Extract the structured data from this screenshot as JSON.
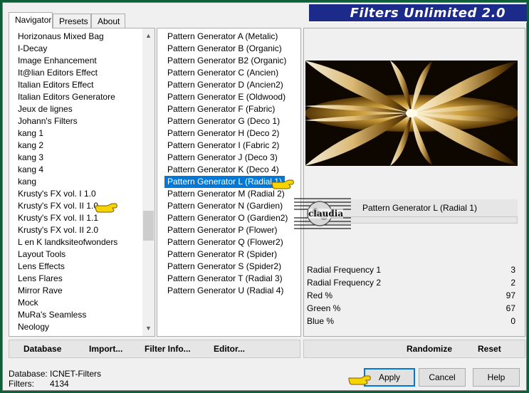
{
  "title": "Filters Unlimited 2.0",
  "tabs": [
    {
      "label": "Navigator",
      "active": true
    },
    {
      "label": "Presets",
      "active": false
    },
    {
      "label": "About",
      "active": false
    }
  ],
  "categories": [
    "Horizonaus Mixed Bag",
    "I-Decay",
    "Image Enhancement",
    "It@lian Editors Effect",
    "Italian Editors Effect",
    "Italian Editors Generatore",
    "Jeux de lignes",
    "Johann's Filters",
    "kang 1",
    "kang 2",
    "kang 3",
    "kang 4",
    "kang",
    "Krusty's FX vol. I 1.0",
    "Krusty's FX vol. II 1.0",
    "Krusty's FX vol. II 1.1",
    "Krusty's FX vol. II 2.0",
    "L en K landksiteofwonders",
    "Layout Tools",
    "Lens Effects",
    "Lens Flares",
    "Mirror Rave",
    "Mock",
    "MuRa's Seamless",
    "Neology"
  ],
  "filters": [
    "Pattern Generator A (Metalic)",
    "Pattern Generator B (Organic)",
    "Pattern Generator B2 (Organic)",
    "Pattern Generator C (Ancien)",
    "Pattern Generator D (Ancien2)",
    "Pattern Generator E (Oldwood)",
    "Pattern Generator F (Fabric)",
    "Pattern Generator G (Deco 1)",
    "Pattern Generator H (Deco 2)",
    "Pattern Generator I (Fabric 2)",
    "Pattern Generator J (Deco 3)",
    "Pattern Generator K (Deco 4)",
    "Pattern Generator L (Radial 1)",
    "Pattern Generator M (Radial 2)",
    "Pattern Generator N (Gardien)",
    "Pattern Generator O (Gardien2)",
    "Pattern Generator P (Flower)",
    "Pattern Generator Q (Flower2)",
    "Pattern Generator R (Spider)",
    "Pattern Generator S (Spider2)",
    "Pattern Generator T (Radial 3)",
    "Pattern Generator U (Radial 4)"
  ],
  "selected_filter_index": 12,
  "current_filter": "Pattern Generator L (Radial 1)",
  "watermark": "claudia",
  "params": [
    {
      "label": "Radial Frequency 1",
      "value": "3"
    },
    {
      "label": "Radial Frequency 2",
      "value": "2"
    },
    {
      "label": "Red %",
      "value": "97"
    },
    {
      "label": "Green %",
      "value": "67"
    },
    {
      "label": "Blue %",
      "value": "0"
    }
  ],
  "toolbar": {
    "database": "Database",
    "import": "Import...",
    "filter_info": "Filter Info...",
    "editor": "Editor...",
    "randomize": "Randomize",
    "reset": "Reset"
  },
  "info": {
    "database_label": "Database:",
    "database_value": "ICNET-Filters",
    "filters_label": "Filters:",
    "filters_value": "4134"
  },
  "buttons": {
    "apply": "Apply",
    "cancel": "Cancel",
    "help": "Help"
  },
  "colors": {
    "selection": "#0078d7",
    "banner": "#1c2a8a",
    "frame": "#0e5e3a",
    "hand": "#f5d400"
  }
}
